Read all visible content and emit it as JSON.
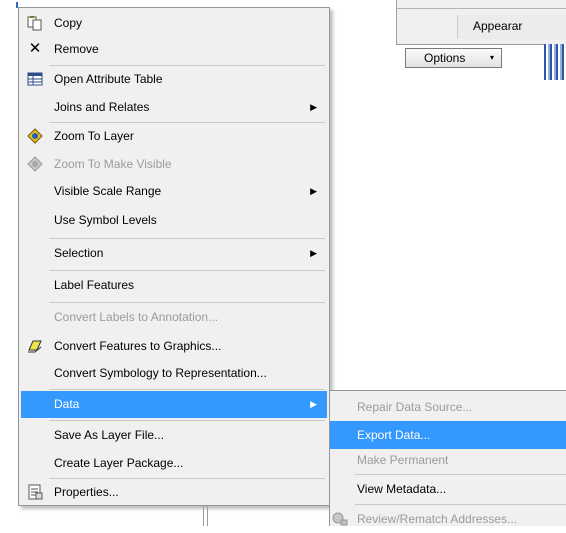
{
  "background_window": {
    "appearance_label": "Appearar",
    "options_button": "Options",
    "options_arrow": "▾"
  },
  "context_menu": {
    "items": [
      {
        "label": "Copy",
        "icon": "copy-icon",
        "glyph": "📋",
        "disabled": false
      },
      {
        "label": "Remove",
        "icon": "remove-icon",
        "glyph": "✕",
        "disabled": false
      },
      {
        "label": "Open Attribute Table",
        "icon": "attribute-table-icon",
        "glyph": "▦",
        "disabled": false
      },
      {
        "label": "Joins and Relates",
        "submenu": true,
        "disabled": false
      },
      {
        "label": "Zoom To Layer",
        "icon": "zoom-to-layer-icon",
        "glyph": "◈",
        "disabled": false
      },
      {
        "label": "Zoom To Make Visible",
        "icon": "zoom-to-make-visible-icon",
        "glyph": "◈",
        "disabled": true
      },
      {
        "label": "Visible Scale Range",
        "submenu": true,
        "disabled": false
      },
      {
        "label": "Use Symbol Levels",
        "disabled": false
      },
      {
        "label": "Selection",
        "submenu": true,
        "disabled": false
      },
      {
        "label": "Label Features",
        "disabled": false
      },
      {
        "label": "Convert Labels to Annotation...",
        "disabled": true
      },
      {
        "label": "Convert Features to Graphics...",
        "icon": "convert-graphics-icon",
        "glyph": "⬡",
        "disabled": false
      },
      {
        "label": "Convert Symbology to Representation...",
        "disabled": false
      },
      {
        "label": "Data",
        "submenu": true,
        "selected": true,
        "disabled": false
      },
      {
        "label": "Save As Layer File...",
        "disabled": false
      },
      {
        "label": "Create Layer Package...",
        "disabled": false
      },
      {
        "label": "Properties...",
        "icon": "properties-icon",
        "glyph": "🗎",
        "disabled": false
      }
    ],
    "submenu_arrow": "▶"
  },
  "data_submenu": {
    "items": [
      {
        "label": "Repair Data Source...",
        "disabled": true
      },
      {
        "label": "Export Data...",
        "selected": true,
        "disabled": false
      },
      {
        "label": "Make Permanent",
        "disabled": true
      },
      {
        "label": "View Metadata...",
        "disabled": false
      },
      {
        "label": "Review/Rematch Addresses...",
        "icon": "review-addresses-icon",
        "glyph": "⚙",
        "disabled": true
      }
    ]
  },
  "colors": {
    "highlight": "#3399ff",
    "menu_bg": "#f0f0f0",
    "disabled_text": "#9b9b9b"
  }
}
